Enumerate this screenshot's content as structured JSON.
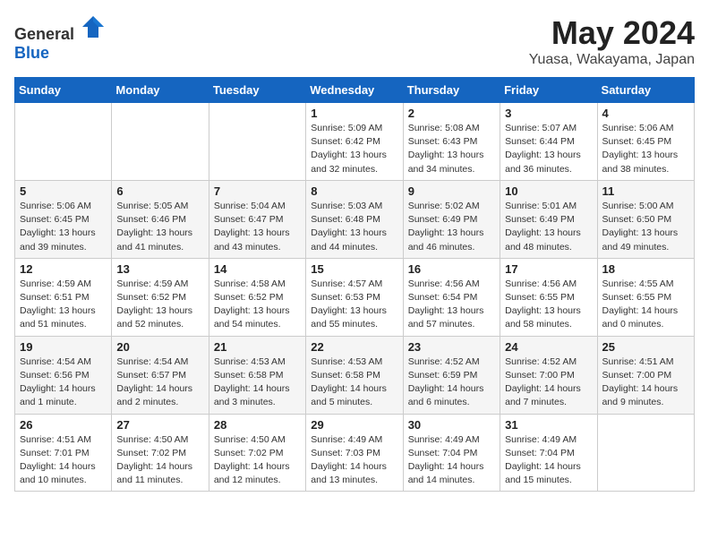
{
  "header": {
    "logo": {
      "text_general": "General",
      "text_blue": "Blue"
    },
    "title": "May 2024",
    "location": "Yuasa, Wakayama, Japan"
  },
  "weekdays": [
    "Sunday",
    "Monday",
    "Tuesday",
    "Wednesday",
    "Thursday",
    "Friday",
    "Saturday"
  ],
  "weeks": [
    [
      {
        "day": "",
        "info": ""
      },
      {
        "day": "",
        "info": ""
      },
      {
        "day": "",
        "info": ""
      },
      {
        "day": "1",
        "info": "Sunrise: 5:09 AM\nSunset: 6:42 PM\nDaylight: 13 hours\nand 32 minutes."
      },
      {
        "day": "2",
        "info": "Sunrise: 5:08 AM\nSunset: 6:43 PM\nDaylight: 13 hours\nand 34 minutes."
      },
      {
        "day": "3",
        "info": "Sunrise: 5:07 AM\nSunset: 6:44 PM\nDaylight: 13 hours\nand 36 minutes."
      },
      {
        "day": "4",
        "info": "Sunrise: 5:06 AM\nSunset: 6:45 PM\nDaylight: 13 hours\nand 38 minutes."
      }
    ],
    [
      {
        "day": "5",
        "info": "Sunrise: 5:06 AM\nSunset: 6:45 PM\nDaylight: 13 hours\nand 39 minutes."
      },
      {
        "day": "6",
        "info": "Sunrise: 5:05 AM\nSunset: 6:46 PM\nDaylight: 13 hours\nand 41 minutes."
      },
      {
        "day": "7",
        "info": "Sunrise: 5:04 AM\nSunset: 6:47 PM\nDaylight: 13 hours\nand 43 minutes."
      },
      {
        "day": "8",
        "info": "Sunrise: 5:03 AM\nSunset: 6:48 PM\nDaylight: 13 hours\nand 44 minutes."
      },
      {
        "day": "9",
        "info": "Sunrise: 5:02 AM\nSunset: 6:49 PM\nDaylight: 13 hours\nand 46 minutes."
      },
      {
        "day": "10",
        "info": "Sunrise: 5:01 AM\nSunset: 6:49 PM\nDaylight: 13 hours\nand 48 minutes."
      },
      {
        "day": "11",
        "info": "Sunrise: 5:00 AM\nSunset: 6:50 PM\nDaylight: 13 hours\nand 49 minutes."
      }
    ],
    [
      {
        "day": "12",
        "info": "Sunrise: 4:59 AM\nSunset: 6:51 PM\nDaylight: 13 hours\nand 51 minutes."
      },
      {
        "day": "13",
        "info": "Sunrise: 4:59 AM\nSunset: 6:52 PM\nDaylight: 13 hours\nand 52 minutes."
      },
      {
        "day": "14",
        "info": "Sunrise: 4:58 AM\nSunset: 6:52 PM\nDaylight: 13 hours\nand 54 minutes."
      },
      {
        "day": "15",
        "info": "Sunrise: 4:57 AM\nSunset: 6:53 PM\nDaylight: 13 hours\nand 55 minutes."
      },
      {
        "day": "16",
        "info": "Sunrise: 4:56 AM\nSunset: 6:54 PM\nDaylight: 13 hours\nand 57 minutes."
      },
      {
        "day": "17",
        "info": "Sunrise: 4:56 AM\nSunset: 6:55 PM\nDaylight: 13 hours\nand 58 minutes."
      },
      {
        "day": "18",
        "info": "Sunrise: 4:55 AM\nSunset: 6:55 PM\nDaylight: 14 hours\nand 0 minutes."
      }
    ],
    [
      {
        "day": "19",
        "info": "Sunrise: 4:54 AM\nSunset: 6:56 PM\nDaylight: 14 hours\nand 1 minute."
      },
      {
        "day": "20",
        "info": "Sunrise: 4:54 AM\nSunset: 6:57 PM\nDaylight: 14 hours\nand 2 minutes."
      },
      {
        "day": "21",
        "info": "Sunrise: 4:53 AM\nSunset: 6:58 PM\nDaylight: 14 hours\nand 3 minutes."
      },
      {
        "day": "22",
        "info": "Sunrise: 4:53 AM\nSunset: 6:58 PM\nDaylight: 14 hours\nand 5 minutes."
      },
      {
        "day": "23",
        "info": "Sunrise: 4:52 AM\nSunset: 6:59 PM\nDaylight: 14 hours\nand 6 minutes."
      },
      {
        "day": "24",
        "info": "Sunrise: 4:52 AM\nSunset: 7:00 PM\nDaylight: 14 hours\nand 7 minutes."
      },
      {
        "day": "25",
        "info": "Sunrise: 4:51 AM\nSunset: 7:00 PM\nDaylight: 14 hours\nand 9 minutes."
      }
    ],
    [
      {
        "day": "26",
        "info": "Sunrise: 4:51 AM\nSunset: 7:01 PM\nDaylight: 14 hours\nand 10 minutes."
      },
      {
        "day": "27",
        "info": "Sunrise: 4:50 AM\nSunset: 7:02 PM\nDaylight: 14 hours\nand 11 minutes."
      },
      {
        "day": "28",
        "info": "Sunrise: 4:50 AM\nSunset: 7:02 PM\nDaylight: 14 hours\nand 12 minutes."
      },
      {
        "day": "29",
        "info": "Sunrise: 4:49 AM\nSunset: 7:03 PM\nDaylight: 14 hours\nand 13 minutes."
      },
      {
        "day": "30",
        "info": "Sunrise: 4:49 AM\nSunset: 7:04 PM\nDaylight: 14 hours\nand 14 minutes."
      },
      {
        "day": "31",
        "info": "Sunrise: 4:49 AM\nSunset: 7:04 PM\nDaylight: 14 hours\nand 15 minutes."
      },
      {
        "day": "",
        "info": ""
      }
    ]
  ]
}
